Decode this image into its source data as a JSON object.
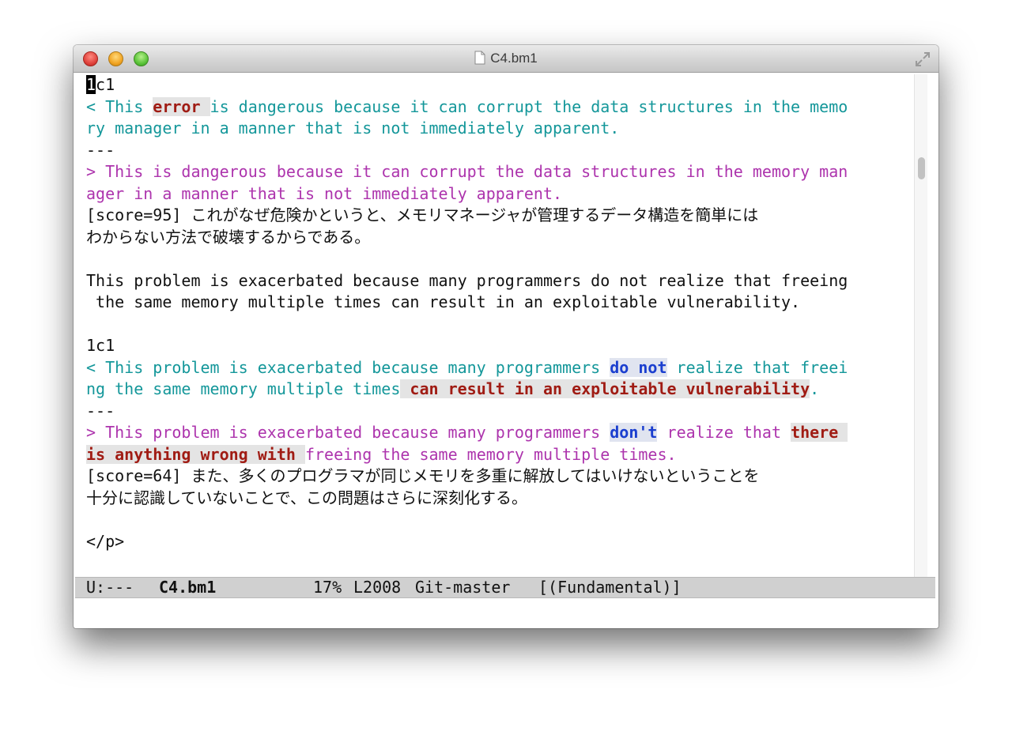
{
  "window": {
    "title": "C4.bm1"
  },
  "editor": {
    "lines": [
      {
        "segments": [
          {
            "t": "1",
            "c": "cursor"
          },
          {
            "t": "c1",
            "c": "black"
          }
        ]
      },
      {
        "cont_right": true,
        "segments": [
          {
            "t": "< This ",
            "c": "cyan"
          },
          {
            "t": "error ",
            "c": "red"
          },
          {
            "t": "is dangerous because it can corrupt the data structures in the memo",
            "c": "cyan"
          }
        ]
      },
      {
        "cont_left": true,
        "segments": [
          {
            "t": "ry manager in a manner that is not immediately apparent.",
            "c": "cyan"
          }
        ]
      },
      {
        "segments": [
          {
            "t": "---",
            "c": "black"
          }
        ]
      },
      {
        "cont_right": true,
        "segments": [
          {
            "t": "> This is dangerous because it can corrupt the data structures in the memory man",
            "c": "purple"
          }
        ]
      },
      {
        "cont_left": true,
        "segments": [
          {
            "t": "ager in a manner that is not immediately apparent.",
            "c": "purple"
          }
        ]
      },
      {
        "cont_right": true,
        "segments": [
          {
            "t": "[score=95] これがなぜ危険かというと、メモリマネージャが管理するデータ構造を簡単には",
            "c": "black"
          }
        ]
      },
      {
        "cont_left": true,
        "segments": [
          {
            "t": "わからない方法で破壊するからである。",
            "c": "black"
          }
        ]
      },
      {
        "segments": []
      },
      {
        "cont_right": true,
        "segments": [
          {
            "t": "This problem is exacerbated because many programmers do not realize that freeing",
            "c": "black"
          }
        ]
      },
      {
        "cont_left": true,
        "segments": [
          {
            "t": " the same memory multiple times can result in an exploitable vulnerability.",
            "c": "black"
          }
        ]
      },
      {
        "segments": []
      },
      {
        "segments": [
          {
            "t": "1c1",
            "c": "black"
          }
        ]
      },
      {
        "cont_right": true,
        "segments": [
          {
            "t": "< This problem is exacerbated because many programmers ",
            "c": "cyan"
          },
          {
            "t": "do not",
            "c": "blue"
          },
          {
            "t": " realize that freei",
            "c": "cyan"
          }
        ]
      },
      {
        "cont_left": true,
        "segments": [
          {
            "t": "ng the same memory multiple times",
            "c": "cyan"
          },
          {
            "t": " can result in an exploitable vulnerability",
            "c": "red"
          },
          {
            "t": ".",
            "c": "cyan"
          }
        ]
      },
      {
        "segments": [
          {
            "t": "---",
            "c": "black"
          }
        ]
      },
      {
        "cont_right": true,
        "segments": [
          {
            "t": "> This problem is exacerbated because many programmers ",
            "c": "purple"
          },
          {
            "t": "don't",
            "c": "blue"
          },
          {
            "t": " realize that ",
            "c": "purple"
          },
          {
            "t": "there ",
            "c": "red"
          }
        ]
      },
      {
        "cont_left": true,
        "segments": [
          {
            "t": "is anything wrong with ",
            "c": "red"
          },
          {
            "t": "freeing the same memory multiple times.",
            "c": "purple"
          }
        ]
      },
      {
        "cont_right": true,
        "segments": [
          {
            "t": "[score=64] また、多くのプログラマが同じメモリを多重に解放してはいけないということを",
            "c": "black"
          }
        ]
      },
      {
        "cont_left": true,
        "segments": [
          {
            "t": "十分に認識していないことで、この問題はさらに深刻化する。",
            "c": "black"
          }
        ]
      },
      {
        "segments": []
      },
      {
        "segments": [
          {
            "t": "</p>",
            "c": "black"
          }
        ]
      }
    ]
  },
  "modeline": {
    "status": "U:---",
    "buffer_name": "C4.bm1",
    "position": "17%",
    "line": "L2008",
    "vcs": "Git-master",
    "mode": "[(Fundamental)]"
  }
}
